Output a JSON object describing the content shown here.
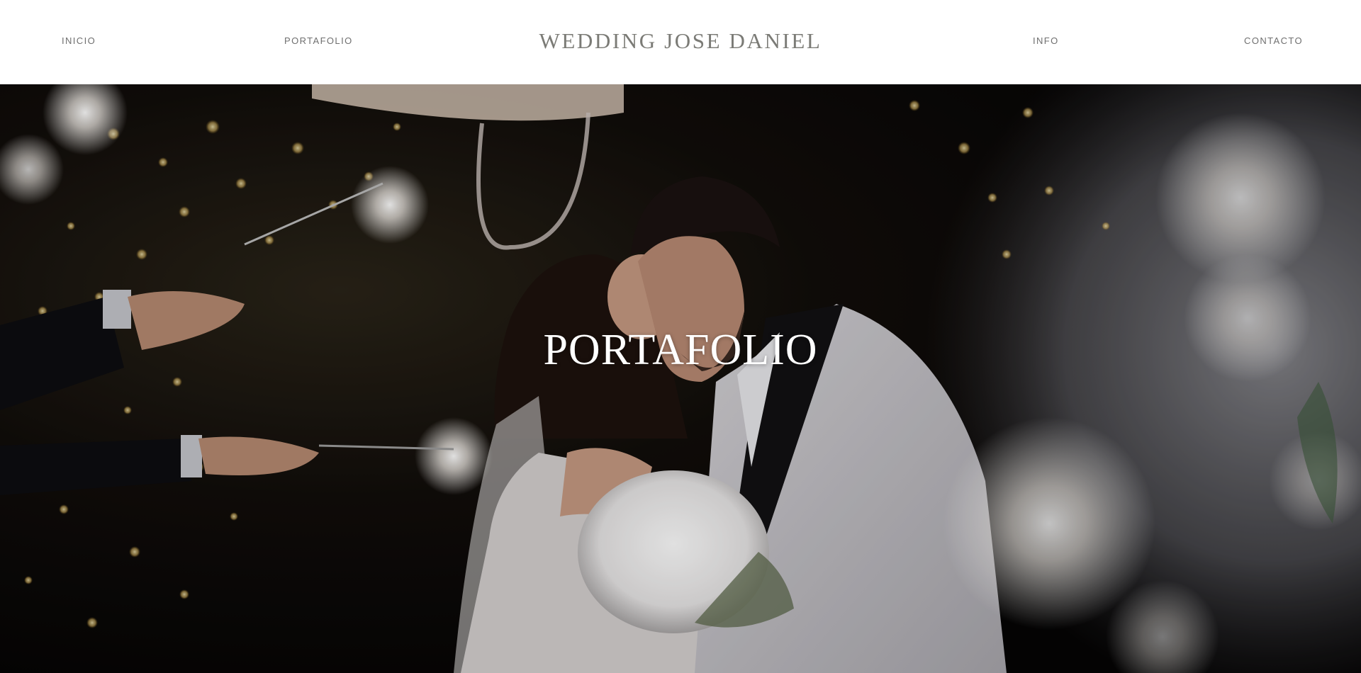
{
  "header": {
    "site_title": "WEDDING JOSE DANIEL",
    "nav": {
      "inicio": "INICIO",
      "portafolio": "PORTAFOLIO",
      "info": "INFO",
      "contacto": "CONTACTO"
    }
  },
  "hero": {
    "heading": "PORTAFOLIO",
    "image": "wedding-couple-kiss-sparklers-photo"
  },
  "colors": {
    "header_background": "#ffffff",
    "nav_text": "#6f6f6f",
    "title_text": "#7b7b76",
    "hero_heading": "#ffffff"
  }
}
